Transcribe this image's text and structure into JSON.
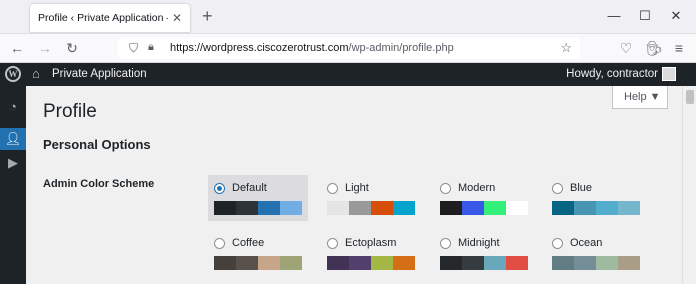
{
  "browser": {
    "tab_title": "Profile ‹ Private Application — WordPress",
    "tab_close_glyph": "✕",
    "new_tab_glyph": "+",
    "url_host": "https://wordpress.ciscozerotrust.com",
    "url_path": "/wp-admin/profile.php"
  },
  "admin_bar": {
    "site_name": "Private Application",
    "howdy": "Howdy, contractor"
  },
  "page": {
    "help_label": "Help ▼",
    "title": "Profile",
    "section": "Personal Options",
    "color_scheme_label": "Admin Color Scheme"
  },
  "color_schemes": [
    {
      "name": "Default",
      "selected": true,
      "colors": [
        "#1d2327",
        "#2c3338",
        "#2271b1",
        "#72aee6"
      ]
    },
    {
      "name": "Light",
      "selected": false,
      "colors": [
        "#e5e5e5",
        "#999999",
        "#d64e07",
        "#04a4cc"
      ]
    },
    {
      "name": "Modern",
      "selected": false,
      "colors": [
        "#1e1e1e",
        "#3858e9",
        "#33f078",
        "#ffffff"
      ]
    },
    {
      "name": "Blue",
      "selected": false,
      "colors": [
        "#096484",
        "#4796b3",
        "#52accc",
        "#74b6ce"
      ]
    },
    {
      "name": "Coffee",
      "selected": false,
      "colors": [
        "#46403c",
        "#59524c",
        "#c7a589",
        "#9ea476"
      ]
    },
    {
      "name": "Ectoplasm",
      "selected": false,
      "colors": [
        "#413256",
        "#523f6d",
        "#a3b745",
        "#d46f15"
      ]
    },
    {
      "name": "Midnight",
      "selected": false,
      "colors": [
        "#25282b",
        "#363b3f",
        "#69a8bb",
        "#e14d43"
      ]
    },
    {
      "name": "Ocean",
      "selected": false,
      "colors": [
        "#627c83",
        "#738e96",
        "#9ebaa0",
        "#aa9d88"
      ]
    }
  ]
}
